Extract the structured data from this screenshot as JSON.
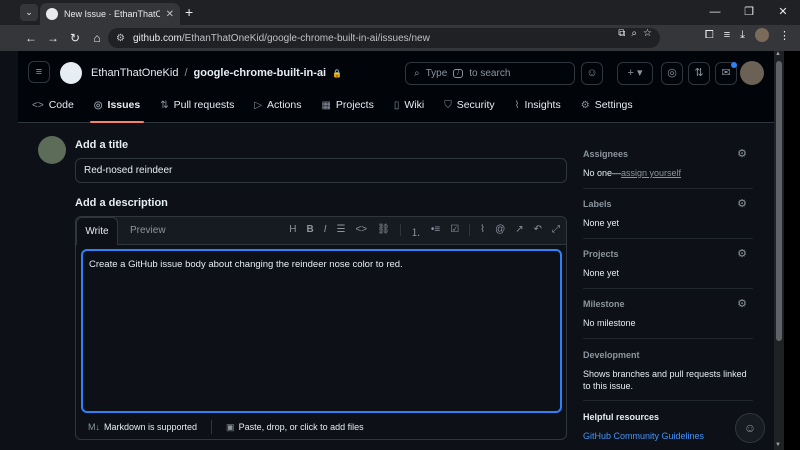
{
  "browser": {
    "tab_title": "New Issue · EthanThatOneKid/g",
    "url_host": "github.com",
    "url_path": "/EthanThatOneKid/google-chrome-built-in-ai/issues/new"
  },
  "header": {
    "owner": "EthanThatOneKid",
    "separator": "/",
    "repo": "google-chrome-built-in-ai",
    "search_prefix": "Type",
    "search_key": "/",
    "search_suffix": "to search"
  },
  "repo_nav": [
    {
      "label": "Code",
      "icon": "code-icon"
    },
    {
      "label": "Issues",
      "icon": "issue-icon"
    },
    {
      "label": "Pull requests",
      "icon": "pull-request-icon"
    },
    {
      "label": "Actions",
      "icon": "play-icon"
    },
    {
      "label": "Projects",
      "icon": "table-icon"
    },
    {
      "label": "Wiki",
      "icon": "book-icon"
    },
    {
      "label": "Security",
      "icon": "shield-icon"
    },
    {
      "label": "Insights",
      "icon": "graph-icon"
    },
    {
      "label": "Settings",
      "icon": "gear-icon"
    }
  ],
  "form": {
    "title_label": "Add a title",
    "title_value": "Red-nosed reindeer",
    "description_label": "Add a description",
    "tab_write": "Write",
    "tab_preview": "Preview",
    "body_value": "Create a GitHub issue body about changing the reindeer nose color to red.",
    "markdown_note": "Markdown is supported",
    "attach_note": "Paste, drop, or click to add files"
  },
  "sidebar": {
    "assignees_head": "Assignees",
    "assignees_none": "No one—",
    "assign_yourself": "assign yourself",
    "labels_head": "Labels",
    "labels_value": "None yet",
    "projects_head": "Projects",
    "projects_value": "None yet",
    "milestone_head": "Milestone",
    "milestone_value": "No milestone",
    "development_head": "Development",
    "development_value": "Shows branches and pull requests linked to this issue.",
    "resources_head": "Helpful resources",
    "resources_link": "GitHub Community Guidelines"
  },
  "colors": {
    "accent": "#2f81f7",
    "active_tab_underline": "#f78166",
    "background": "#0d1117"
  }
}
